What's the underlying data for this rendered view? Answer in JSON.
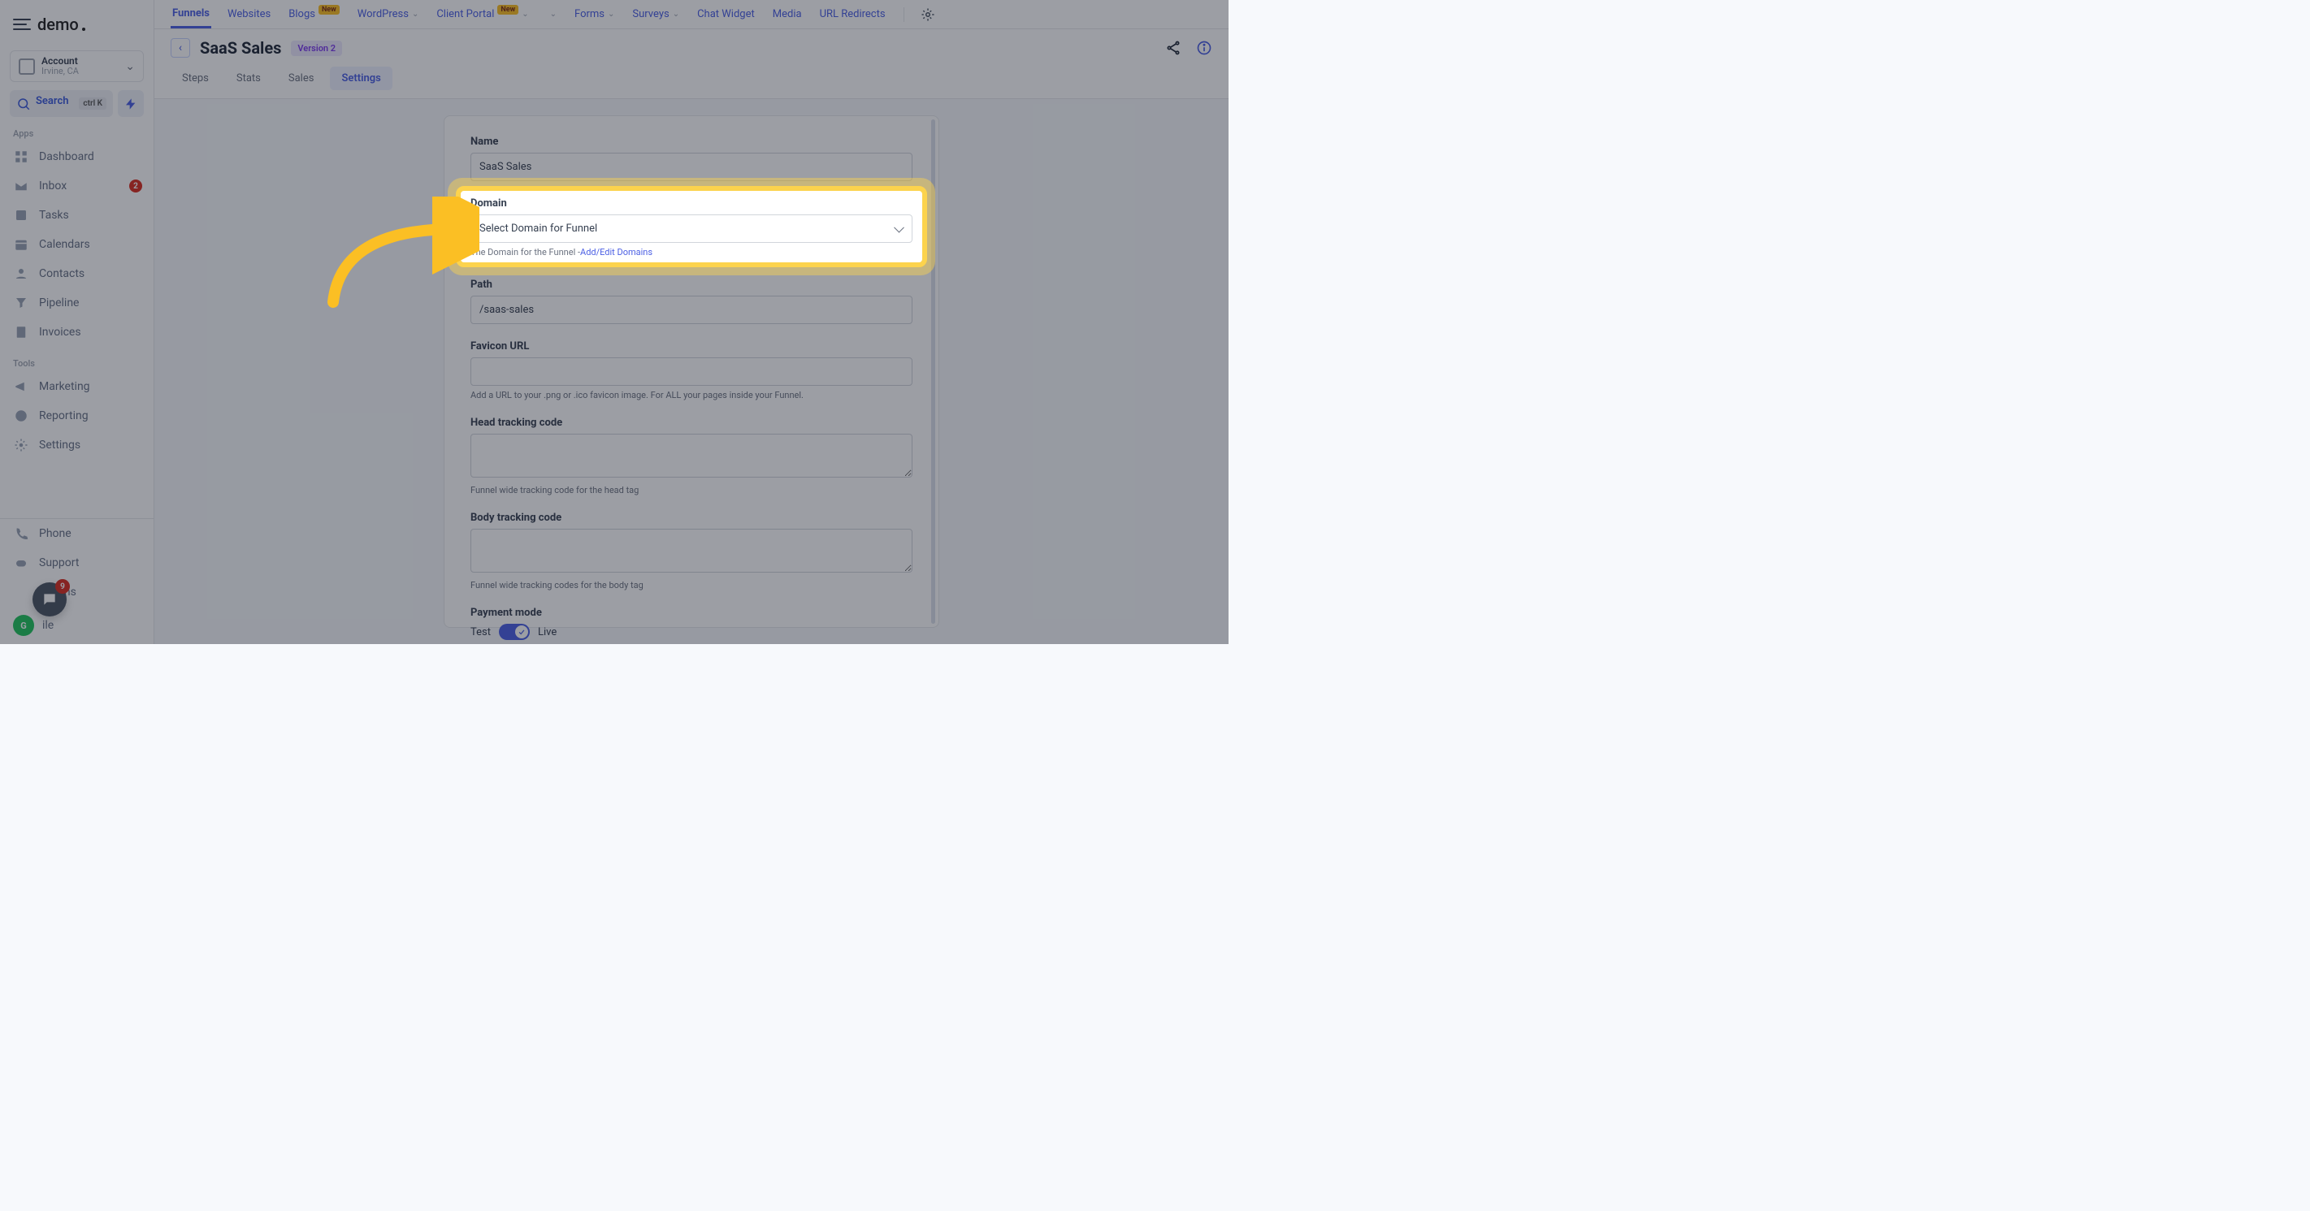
{
  "brand": "demo",
  "account": {
    "label": "Account",
    "sub": "Irvine, CA"
  },
  "search": {
    "label": "Search",
    "kbd": "ctrl K"
  },
  "sections": {
    "apps": "Apps",
    "tools": "Tools"
  },
  "nav_apps": [
    {
      "label": "Dashboard"
    },
    {
      "label": "Inbox",
      "badge": "2"
    },
    {
      "label": "Tasks"
    },
    {
      "label": "Calendars"
    },
    {
      "label": "Contacts"
    },
    {
      "label": "Pipeline"
    },
    {
      "label": "Invoices"
    }
  ],
  "nav_tools": [
    {
      "label": "Marketing"
    },
    {
      "label": "Reporting"
    },
    {
      "label": "Settings"
    }
  ],
  "nav_bottom": [
    {
      "label": "Phone"
    },
    {
      "label": "Support"
    },
    {
      "label": "cations"
    },
    {
      "label": "ile"
    }
  ],
  "chat_badge": "9",
  "avatar": "G",
  "topnav": {
    "items": [
      "Funnels",
      "Websites",
      "Blogs",
      "WordPress",
      "Client Portal",
      "",
      "Forms",
      "Surveys",
      "Chat Widget",
      "Media",
      "URL Redirects"
    ],
    "new_after": [
      2,
      4
    ],
    "chev_after": [
      3,
      4,
      5,
      6,
      7
    ]
  },
  "titlebar": {
    "title": "SaaS Sales",
    "version": "Version 2"
  },
  "subtabs": [
    "Steps",
    "Stats",
    "Sales",
    "Settings"
  ],
  "form": {
    "name": {
      "label": "Name",
      "value": "SaaS Sales"
    },
    "domain": {
      "label": "Domain",
      "placeholder": "Select Domain for Funnel",
      "help_pre": "The Domain for the Funnel -",
      "help_link": "Add/Edit Domains"
    },
    "path": {
      "label": "Path",
      "value": "/saas-sales"
    },
    "favicon": {
      "label": "Favicon URL",
      "value": "",
      "help": "Add a URL to your .png or .ico favicon image. For ALL your pages inside your Funnel."
    },
    "head": {
      "label": "Head tracking code",
      "value": "",
      "help": "Funnel wide tracking code for the head tag"
    },
    "body": {
      "label": "Body tracking code",
      "value": "",
      "help": "Funnel wide tracking codes for the body tag"
    },
    "payment": {
      "label": "Payment mode",
      "left": "Test",
      "right": "Live"
    }
  }
}
